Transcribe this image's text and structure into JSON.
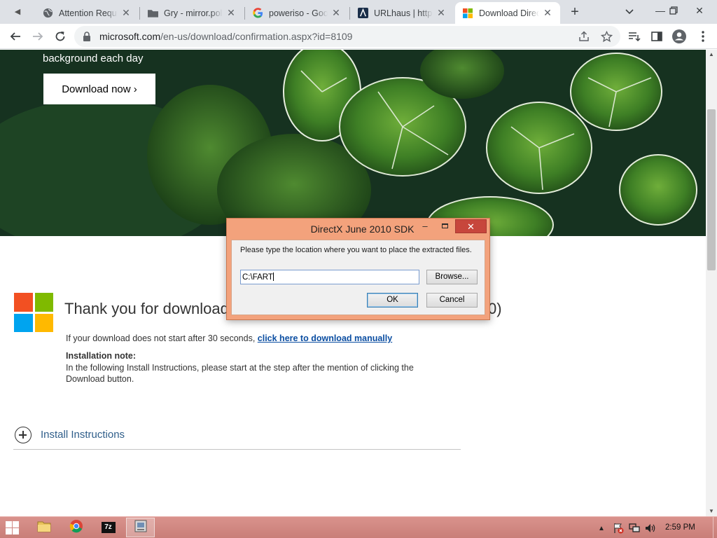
{
  "browser": {
    "tabs": [
      {
        "title": "Attention Requi",
        "icon": "globe-icon",
        "active": false
      },
      {
        "title": "Gry - mirror.pol",
        "icon": "folder-icon",
        "active": false
      },
      {
        "title": "poweriso - Goog",
        "icon": "google-icon",
        "active": false
      },
      {
        "title": "URLhaus | https:",
        "icon": "urlhaus-icon",
        "active": false
      },
      {
        "title": "Download Direc",
        "icon": "microsoft-icon",
        "active": true
      }
    ],
    "new_tab_label": "+",
    "url_domain": "microsoft.com",
    "url_path": "/en-us/download/confirmation.aspx?id=8109"
  },
  "hero": {
    "text": "background each day",
    "button_label": "Download now",
    "button_chevron": "›"
  },
  "content": {
    "thanks_prefix": "Thank you for download",
    "thanks_suffix": "0)",
    "download_note": "If your download does not start after 30 seconds, ",
    "download_link": "click here to download manually",
    "installation_title": "Installation note:",
    "installation_body": "In the following Install Instructions, please start at the step after the mention of clicking the Download button.",
    "install_instructions_label": "Install Instructions"
  },
  "dialog": {
    "title": "DirectX June 2010 SDK",
    "message": "Please type the location where you want to place the extracted files.",
    "path_value": "C:\\FART",
    "browse_label": "Browse...",
    "ok_label": "OK",
    "cancel_label": "Cancel",
    "close_glyph": "✕",
    "minimize_glyph": "–"
  },
  "taskbar": {
    "clock": "2:59 PM",
    "apps": [
      {
        "name": "file-explorer-icon"
      },
      {
        "name": "chrome-icon"
      },
      {
        "name": "7zip-icon",
        "label": "7z"
      },
      {
        "name": "installer-icon"
      }
    ]
  },
  "colors": {
    "dialog_frame": "#f3a27c",
    "taskbar": "#cf8780",
    "link": "#0b4ea2",
    "ms_red": "#f25022",
    "ms_green": "#7fba00",
    "ms_blue": "#00a4ef",
    "ms_yellow": "#ffb900"
  }
}
